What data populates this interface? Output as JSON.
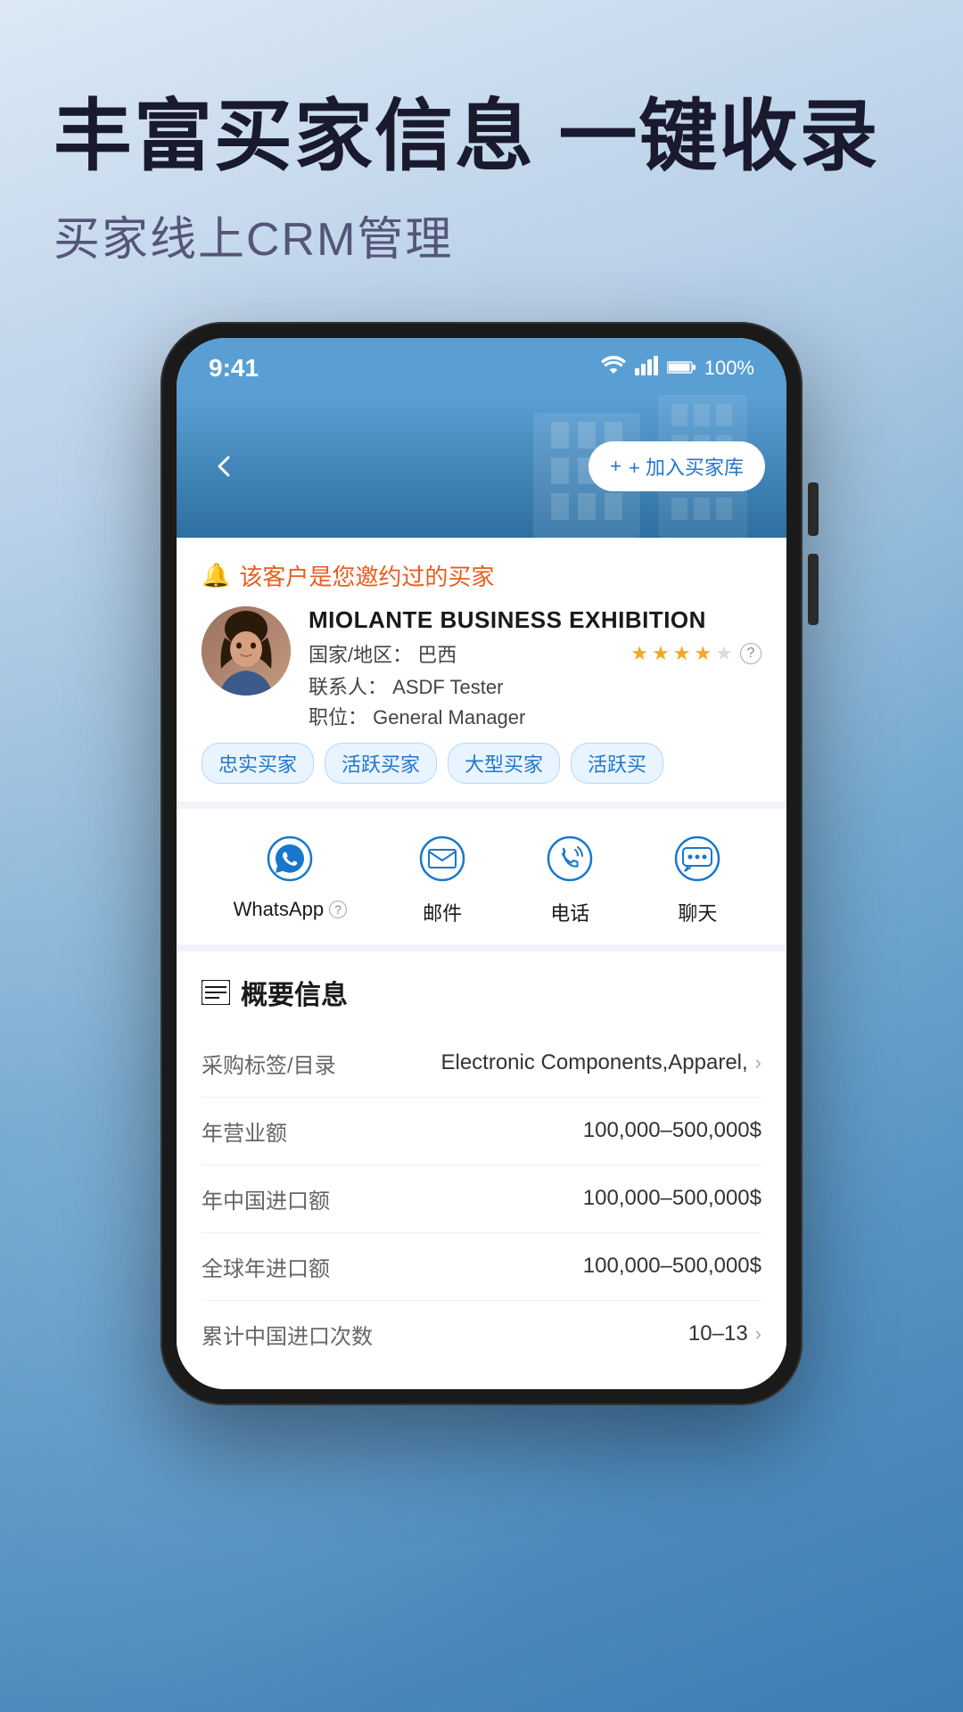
{
  "header": {
    "main_title": "丰富买家信息 一键收录",
    "sub_title": "买家线上CRM管理"
  },
  "phone": {
    "status_bar": {
      "time": "9:41",
      "battery": "100%"
    },
    "app_header": {
      "back_label": "‹",
      "add_buyer_label": "+ 加入买家库"
    },
    "notice": {
      "text": "该客户是您邀约过的买家"
    },
    "buyer": {
      "name": "MIOLANTE BUSINESS EXHIBITION",
      "country_label": "国家/地区：",
      "country": "巴西",
      "contact_label": "联系人：",
      "contact": "ASDF Tester",
      "position_label": "职位：",
      "position": "General Manager",
      "stars_filled": 4,
      "stars_total": 5
    },
    "tags": [
      "忠实买家",
      "活跃买家",
      "大型买家",
      "活跃买"
    ],
    "actions": [
      {
        "label": "WhatsApp",
        "icon": "whatsapp-icon",
        "has_help": true
      },
      {
        "label": "邮件",
        "icon": "email-icon",
        "has_help": false
      },
      {
        "label": "电话",
        "icon": "phone-icon",
        "has_help": false
      },
      {
        "label": "聊天",
        "icon": "chat-icon",
        "has_help": false
      }
    ],
    "overview": {
      "section_title": "概要信息",
      "rows": [
        {
          "label": "采购标签/目录",
          "value": "Electronic Components,Apparel,",
          "has_chevron": true
        },
        {
          "label": "年营业额",
          "value": "100,000–500,000$",
          "has_chevron": false
        },
        {
          "label": "年中国进口额",
          "value": "100,000–500,000$",
          "has_chevron": false
        },
        {
          "label": "全球年进口额",
          "value": "100,000–500,000$",
          "has_chevron": false
        },
        {
          "label": "累计中国进口次数",
          "value": "10–13",
          "has_chevron": true
        }
      ]
    }
  }
}
